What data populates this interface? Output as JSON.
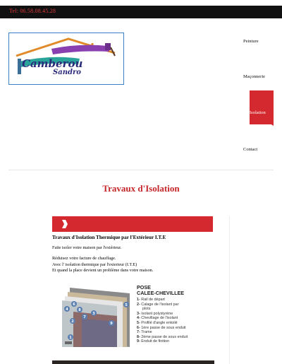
{
  "header": {
    "phone": "Tel: 06.58.08.45.28",
    "accent_color": "#d42a2f",
    "bar_color": "#111111"
  },
  "logo": {
    "line1": "Camberou",
    "line2": "Sandro",
    "roof_color": "#e08a2a",
    "brush_color": "#8a3fb0"
  },
  "nav": {
    "items": [
      {
        "label": "Peinture",
        "active": false
      },
      {
        "label": "Maçonnerie",
        "active": false
      },
      {
        "label": "Isolation",
        "active": true
      },
      {
        "label": "Contact",
        "active": false
      }
    ]
  },
  "main": {
    "title": "Travaux d'Isolation",
    "section_heading": "Travaux d'Isolation Thermique par l'Extérieur  I.T.E",
    "intro": "Faite isoler votre maison par l'extérieur.",
    "paragraph_lines": [
      "Réduisez votre facture de chauffage.",
      "Avec l' isolation thermique par l'exterieur (I.T.E)",
      "Et quand la place devient un problème dans votre maison."
    ]
  },
  "diagram": {
    "title_line1": "POSE",
    "title_line2": "CALEE-CHEVILLEE",
    "legend": [
      {
        "num": "1-",
        "text": "Rail de départ"
      },
      {
        "num": "2-",
        "text": "Calage de l'isolant par"
      },
      {
        "num": "",
        "text": "plots"
      },
      {
        "num": "3-",
        "text": "Isolant polystyrène"
      },
      {
        "num": "4-",
        "text": "Chevillage de l'isolant"
      },
      {
        "num": "5-",
        "text": "Profilé d'angle entoilé"
      },
      {
        "num": "6-",
        "text": "1ère passe de sous enduit"
      },
      {
        "num": "7-",
        "text": "Trame"
      },
      {
        "num": "8-",
        "text": "2ème passe de sous enduit"
      },
      {
        "num": "9-",
        "text": "Enduit de finition"
      }
    ],
    "markers": [
      "1",
      "2",
      "3",
      "4",
      "5",
      "6",
      "7",
      "8",
      "9"
    ]
  }
}
